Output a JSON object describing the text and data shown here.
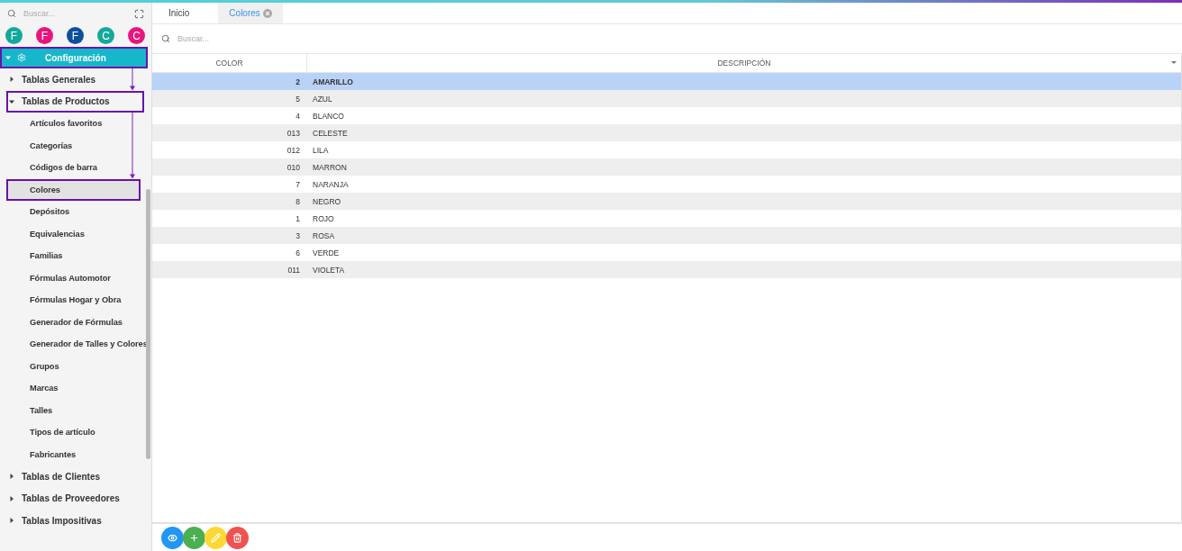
{
  "sidebar": {
    "search": {
      "placeholder": "Buscar..."
    },
    "avatars": [
      {
        "letter": "F",
        "color": "#14a89a"
      },
      {
        "letter": "F",
        "color": "#e8157c"
      },
      {
        "letter": "F",
        "color": "#0d4f9c"
      },
      {
        "letter": "C",
        "color": "#14a89a"
      },
      {
        "letter": "C",
        "color": "#e8157c"
      }
    ],
    "menu": [
      {
        "label": "Configuración",
        "kind": "section",
        "expanded": true,
        "annotated": true,
        "children": [
          {
            "label": "Tablas Generales",
            "kind": "group",
            "expanded": false,
            "annotated": false
          },
          {
            "label": "Tablas de Productos",
            "kind": "group",
            "expanded": true,
            "annotated": true,
            "children": [
              {
                "label": "Artículos favoritos",
                "kind": "item",
                "selected": false,
                "annotated": false
              },
              {
                "label": "Categorías",
                "kind": "item",
                "selected": false,
                "annotated": false
              },
              {
                "label": "Códigos de barra",
                "kind": "item",
                "selected": false,
                "annotated": false
              },
              {
                "label": "Colores",
                "kind": "item",
                "selected": true,
                "annotated": true
              },
              {
                "label": "Depósitos",
                "kind": "item",
                "selected": false,
                "annotated": false
              },
              {
                "label": "Equivalencias",
                "kind": "item",
                "selected": false,
                "annotated": false
              },
              {
                "label": "Familias",
                "kind": "item",
                "selected": false,
                "annotated": false
              },
              {
                "label": "Fórmulas Automotor",
                "kind": "item",
                "selected": false,
                "annotated": false
              },
              {
                "label": "Fórmulas Hogar y Obra",
                "kind": "item",
                "selected": false,
                "annotated": false
              },
              {
                "label": "Generador de Fórmulas",
                "kind": "item",
                "selected": false,
                "annotated": false
              },
              {
                "label": "Generador de Talles y Colores",
                "kind": "item",
                "selected": false,
                "annotated": false
              },
              {
                "label": "Grupos",
                "kind": "item",
                "selected": false,
                "annotated": false
              },
              {
                "label": "Marcas",
                "kind": "item",
                "selected": false,
                "annotated": false
              },
              {
                "label": "Talles",
                "kind": "item",
                "selected": false,
                "annotated": false
              },
              {
                "label": "Tipos de artículo",
                "kind": "item",
                "selected": false,
                "annotated": false
              },
              {
                "label": "Fabricantes",
                "kind": "item",
                "selected": false,
                "annotated": false
              }
            ]
          },
          {
            "label": "Tablas de Clientes",
            "kind": "group",
            "expanded": false,
            "annotated": false
          },
          {
            "label": "Tablas de Proveedores",
            "kind": "group",
            "expanded": false,
            "annotated": false
          },
          {
            "label": "Tablas Impositivas",
            "kind": "group",
            "expanded": false,
            "annotated": false
          }
        ]
      }
    ]
  },
  "tabs": [
    {
      "label": "Inicio",
      "selected": false,
      "closable": false
    },
    {
      "label": "Colores",
      "selected": true,
      "closable": true
    }
  ],
  "search": {
    "placeholder": "Buscar..."
  },
  "table": {
    "columns": [
      "COLOR",
      "DESCRIPCIÓN"
    ],
    "rows": [
      {
        "cells": [
          "2",
          "AMARILLO"
        ],
        "selected": true
      },
      {
        "cells": [
          "5",
          "AZUL"
        ],
        "selected": false
      },
      {
        "cells": [
          "4",
          "BLANCO"
        ],
        "selected": false
      },
      {
        "cells": [
          "013",
          "CELESTE"
        ],
        "selected": false
      },
      {
        "cells": [
          "012",
          "LILA"
        ],
        "selected": false
      },
      {
        "cells": [
          "010",
          "MARRON"
        ],
        "selected": false
      },
      {
        "cells": [
          "7",
          "NARANJA"
        ],
        "selected": false
      },
      {
        "cells": [
          "8",
          "NEGRO"
        ],
        "selected": false
      },
      {
        "cells": [
          "1",
          "ROJO"
        ],
        "selected": false
      },
      {
        "cells": [
          "3",
          "ROSA"
        ],
        "selected": false
      },
      {
        "cells": [
          "6",
          "VERDE"
        ],
        "selected": false
      },
      {
        "cells": [
          "011",
          "VIOLETA"
        ],
        "selected": false
      }
    ]
  },
  "actions": [
    {
      "kind": "view"
    },
    {
      "kind": "add"
    },
    {
      "kind": "edit"
    },
    {
      "kind": "delete"
    }
  ]
}
